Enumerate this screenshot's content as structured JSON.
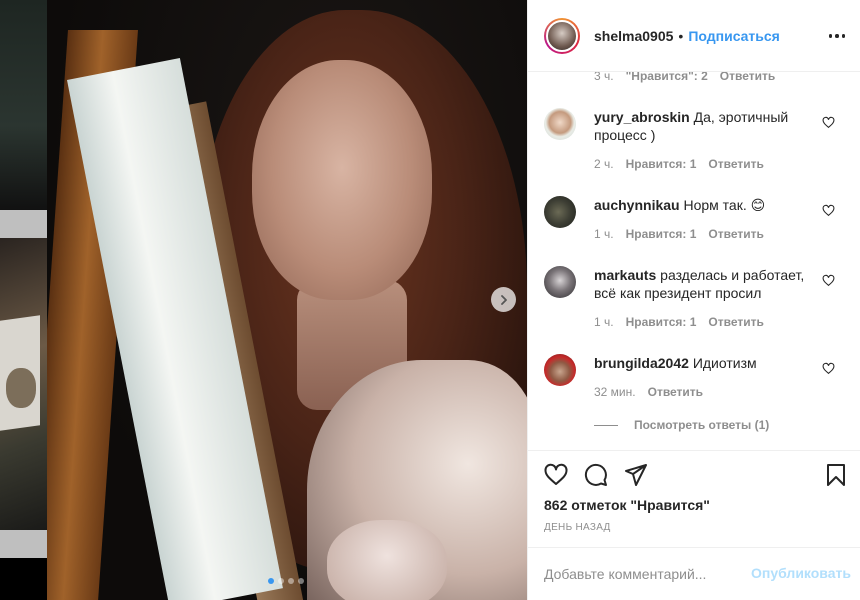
{
  "header": {
    "username": "shelma0905",
    "separator": "•",
    "follow_label": "Подписаться"
  },
  "top_meta": {
    "time": "3 ч.",
    "likes": "\"Нравится\": 2",
    "reply": "Ответить"
  },
  "comments": [
    {
      "username": "yury_abroskin",
      "text": "Да, эротичный процесс )",
      "time": "2 ч.",
      "likes": "Нравится: 1",
      "reply": "Ответить"
    },
    {
      "username": "auchynnikau",
      "text": "Норм так. 😊",
      "time": "1 ч.",
      "likes": "Нравится: 1",
      "reply": "Ответить"
    },
    {
      "username": "markauts",
      "text": "разделась и работает, всё как президент просил",
      "time": "1 ч.",
      "likes": "Нравится: 1",
      "reply": "Ответить"
    },
    {
      "username": "brungilda2042",
      "text": "Идиотизм",
      "time": "32 мин.",
      "reply": "Ответить"
    }
  ],
  "view_replies": "Посмотреть ответы (1)",
  "likes_count": "862 отметок \"Нравится\"",
  "post_date": "ДЕНЬ НАЗАД",
  "add_comment": {
    "placeholder": "Добавьте комментарий...",
    "publish_label": "Опубликовать"
  },
  "carousel": {
    "total": 4,
    "active": 1
  },
  "colors": {
    "accent": "#3897f0",
    "publish_disabled": "#b2dffc",
    "muted": "#8e8e8e",
    "text": "#262626"
  },
  "icons": [
    "more-options-icon",
    "heart-icon",
    "comment-icon",
    "share-icon",
    "bookmark-icon",
    "next-arrow-icon",
    "small-heart-icon"
  ]
}
